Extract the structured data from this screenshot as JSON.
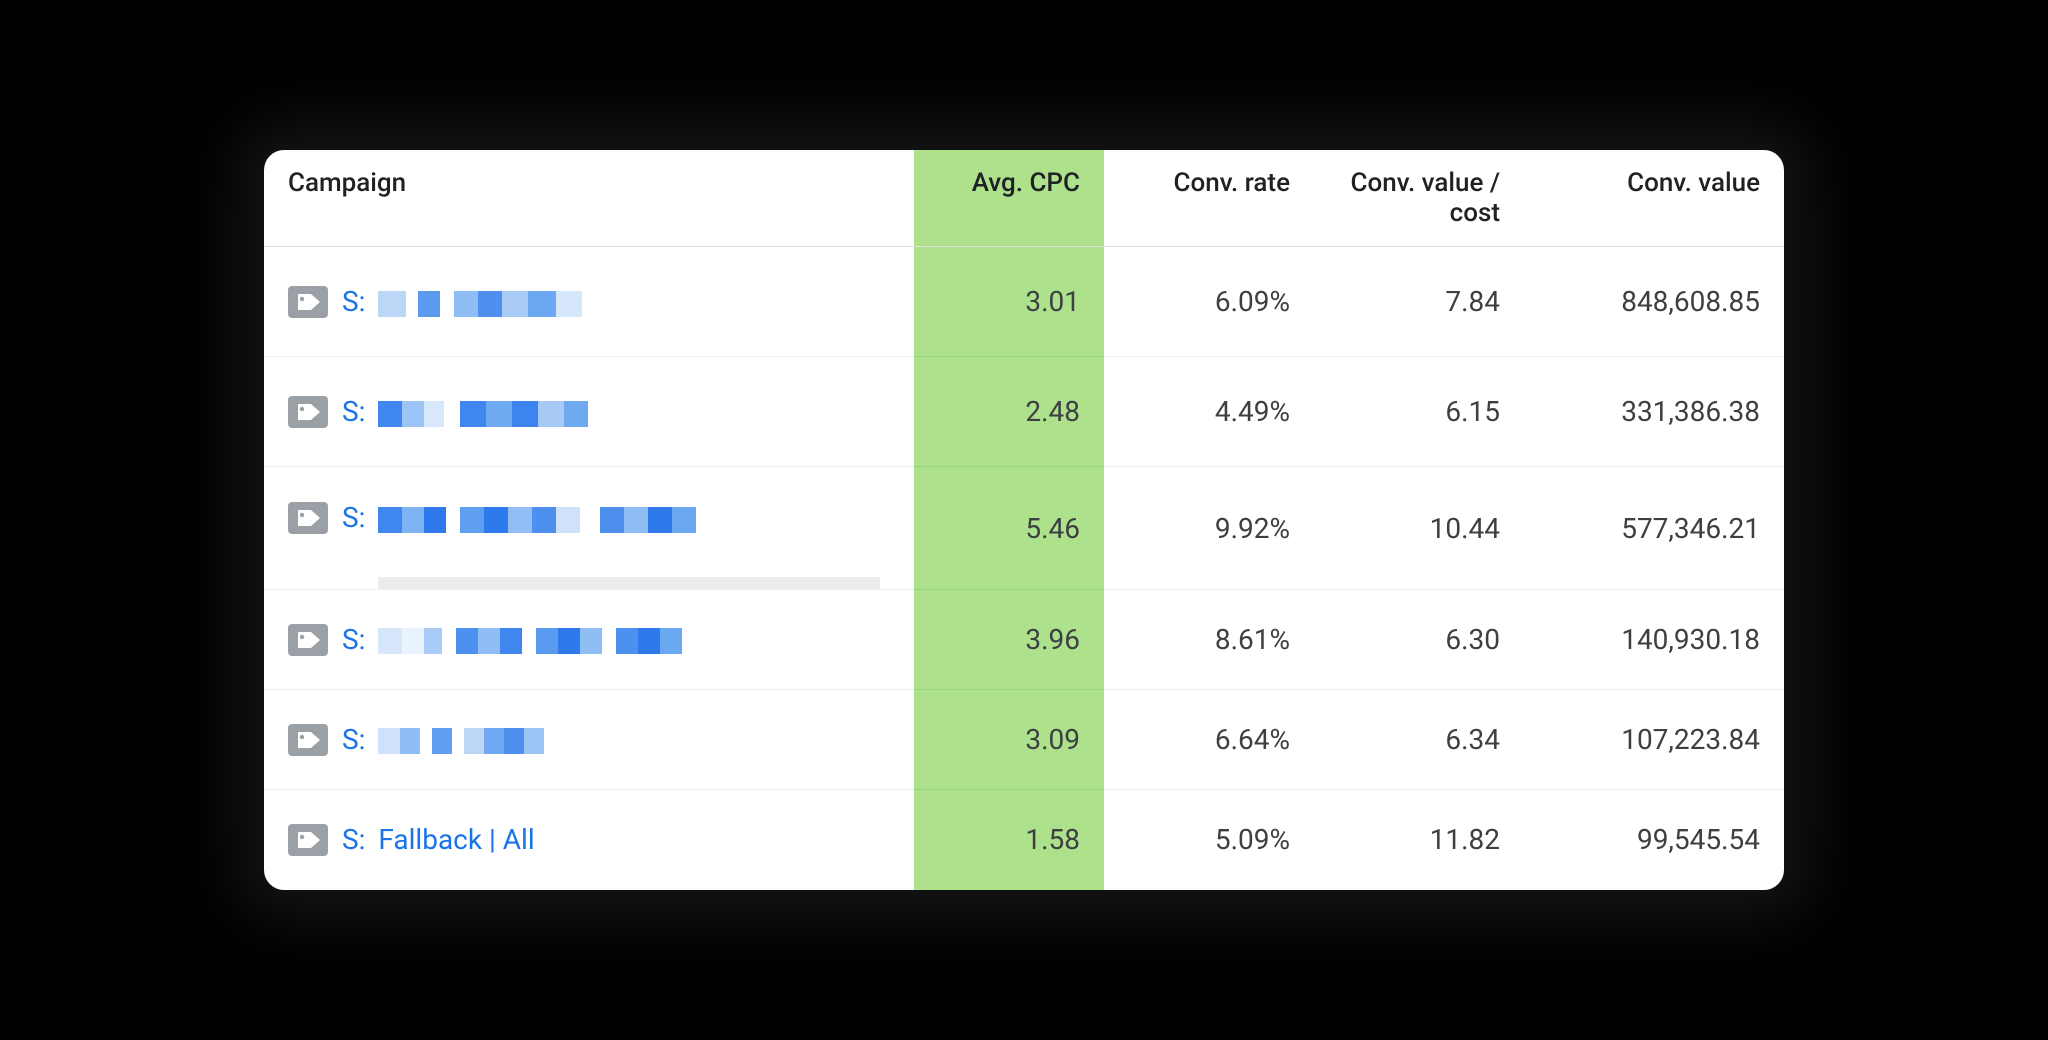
{
  "headers": {
    "campaign": "Campaign",
    "avg_cpc": "Avg. CPC",
    "conv_rate": "Conv. rate",
    "conv_value_cost": "Conv. value / cost",
    "conv_value": "Conv. value"
  },
  "rows": [
    {
      "prefix": "S:",
      "name_redacted": true,
      "name": "",
      "avg_cpc": "3.01",
      "conv_rate": "6.09%",
      "conv_value_cost": "7.84",
      "conv_value": "848,608.85"
    },
    {
      "prefix": "S:",
      "name_redacted": true,
      "name": "",
      "avg_cpc": "2.48",
      "conv_rate": "4.49%",
      "conv_value_cost": "6.15",
      "conv_value": "331,386.38"
    },
    {
      "prefix": "S:",
      "name_redacted": true,
      "name": "",
      "avg_cpc": "5.46",
      "conv_rate": "9.92%",
      "conv_value_cost": "10.44",
      "conv_value": "577,346.21"
    },
    {
      "prefix": "S:",
      "name_redacted": true,
      "name": "",
      "avg_cpc": "3.96",
      "conv_rate": "8.61%",
      "conv_value_cost": "6.30",
      "conv_value": "140,930.18"
    },
    {
      "prefix": "S:",
      "name_redacted": true,
      "name": "",
      "avg_cpc": "3.09",
      "conv_rate": "6.64%",
      "conv_value_cost": "6.34",
      "conv_value": "107,223.84"
    },
    {
      "prefix": "S:",
      "name_redacted": false,
      "name": "Fallback | All",
      "avg_cpc": "1.58",
      "conv_rate": "5.09%",
      "conv_value_cost": "11.82",
      "conv_value": "99,545.54"
    }
  ],
  "highlight_column": "avg_cpc"
}
